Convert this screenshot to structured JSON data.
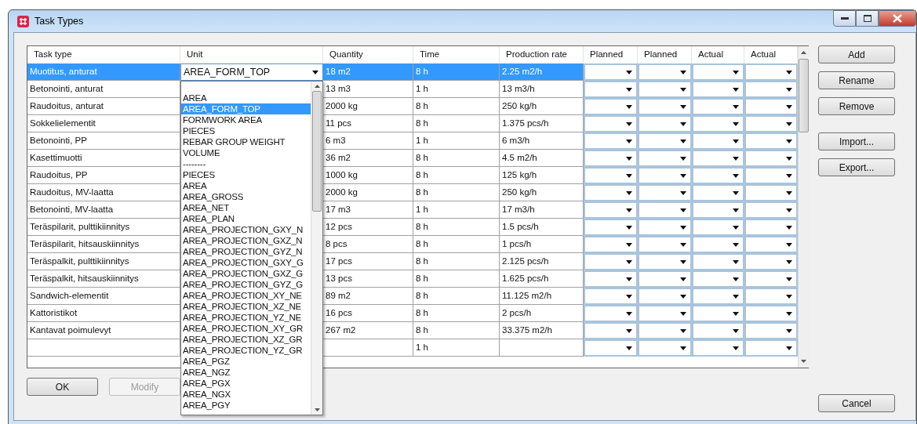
{
  "window": {
    "title": "Task Types"
  },
  "table": {
    "columns": [
      "Task type",
      "Unit",
      "Quantity",
      "Time",
      "Production rate",
      "Planned",
      "Planned",
      "Actual",
      "Actual"
    ],
    "rows": [
      {
        "task_type": "Muotitus, anturat",
        "unit": "AREA_FORM_TOP",
        "quantity": "18 m2",
        "time": "8 h",
        "rate": "2.25 m2/h",
        "selected": true
      },
      {
        "task_type": "Betonointi, anturat",
        "quantity": "13 m3",
        "time": "1 h",
        "rate": "13 m3/h",
        "selected": false
      },
      {
        "task_type": "Raudoitus, anturat",
        "quantity": "2000 kg",
        "time": "8 h",
        "rate": "250 kg/h",
        "selected": false
      },
      {
        "task_type": "Sokkelielementit",
        "quantity": "11 pcs",
        "time": "8 h",
        "rate": "1.375 pcs/h",
        "selected": false
      },
      {
        "task_type": "Betonointi, PP",
        "quantity": "6 m3",
        "time": "1 h",
        "rate": "6 m3/h",
        "selected": false
      },
      {
        "task_type": "Kasettimuotti",
        "quantity": "36 m2",
        "time": "8 h",
        "rate": "4.5 m2/h",
        "selected": false
      },
      {
        "task_type": "Raudoitus, PP",
        "quantity": "1000 kg",
        "time": "8 h",
        "rate": "125 kg/h",
        "selected": false
      },
      {
        "task_type": "Raudoitus, MV-laatta",
        "quantity": "2000 kg",
        "time": "8 h",
        "rate": "250 kg/h",
        "selected": false
      },
      {
        "task_type": "Betonointi, MV-laatta",
        "quantity": "17 m3",
        "time": "1 h",
        "rate": "17 m3/h",
        "selected": false
      },
      {
        "task_type": "Teräspilarit, pulttikiinnitys",
        "quantity": "12 pcs",
        "time": "8 h",
        "rate": "1.5 pcs/h",
        "selected": false
      },
      {
        "task_type": "Teräspilarit, hitsauskiinnitys",
        "quantity": "8 pcs",
        "time": "8 h",
        "rate": "1 pcs/h",
        "selected": false
      },
      {
        "task_type": "Teräspalkit, pulttikiinnitys",
        "quantity": "17 pcs",
        "time": "8 h",
        "rate": "2.125 pcs/h",
        "selected": false
      },
      {
        "task_type": "Teräspalkit, hitsauskiinnitys",
        "quantity": "13 pcs",
        "time": "8 h",
        "rate": "1.625 pcs/h",
        "selected": false
      },
      {
        "task_type": "Sandwich-elementit",
        "quantity": "89 m2",
        "time": "8 h",
        "rate": "11.125 m2/h",
        "selected": false
      },
      {
        "task_type": "Kattoristikot",
        "quantity": "16 pcs",
        "time": "8 h",
        "rate": "2 pcs/h",
        "selected": false
      },
      {
        "task_type": "Kantavat poimulevyt",
        "quantity": "267 m2",
        "time": "8 h",
        "rate": "33.375 m2/h",
        "selected": false
      },
      {
        "time": "1 h",
        "selected": false
      }
    ]
  },
  "unit_list": [
    {
      "label": "AREA",
      "selected": false
    },
    {
      "label": "AREA_FORM_TOP",
      "selected": true
    },
    {
      "label": "FORMWORK AREA",
      "selected": false
    },
    {
      "label": "PIECES",
      "selected": false
    },
    {
      "label": "REBAR GROUP WEIGHT",
      "selected": false
    },
    {
      "label": "VOLUME",
      "selected": false
    },
    {
      "label": "--------",
      "selected": false
    },
    {
      "label": "PIECES",
      "selected": false
    },
    {
      "label": "AREA",
      "selected": false
    },
    {
      "label": "AREA_GROSS",
      "selected": false
    },
    {
      "label": "AREA_NET",
      "selected": false
    },
    {
      "label": "AREA_PLAN",
      "selected": false
    },
    {
      "label": "AREA_PROJECTION_GXY_N",
      "selected": false
    },
    {
      "label": "AREA_PROJECTION_GXZ_N",
      "selected": false
    },
    {
      "label": "AREA_PROJECTION_GYZ_N",
      "selected": false
    },
    {
      "label": "AREA_PROJECTION_GXY_G",
      "selected": false
    },
    {
      "label": "AREA_PROJECTION_GXZ_G",
      "selected": false
    },
    {
      "label": "AREA_PROJECTION_GYZ_G",
      "selected": false
    },
    {
      "label": "AREA_PROJECTION_XY_NE",
      "selected": false
    },
    {
      "label": "AREA_PROJECTION_XZ_NE",
      "selected": false
    },
    {
      "label": "AREA_PROJECTION_YZ_NE",
      "selected": false
    },
    {
      "label": "AREA_PROJECTION_XY_GR",
      "selected": false
    },
    {
      "label": "AREA_PROJECTION_XZ_GR",
      "selected": false
    },
    {
      "label": "AREA_PROJECTION_YZ_GR",
      "selected": false
    },
    {
      "label": "AREA_PGZ",
      "selected": false
    },
    {
      "label": "AREA_NGZ",
      "selected": false
    },
    {
      "label": "AREA_PGX",
      "selected": false
    },
    {
      "label": "AREA_NGX",
      "selected": false
    },
    {
      "label": "AREA_PGY",
      "selected": false
    }
  ],
  "side_buttons": [
    "Add",
    "Rename",
    "Remove",
    "Import...",
    "Export..."
  ],
  "bottom_buttons": [
    {
      "label": "OK",
      "disabled": false
    },
    {
      "label": "Modify",
      "disabled": true
    }
  ],
  "cancel_button": "Cancel"
}
